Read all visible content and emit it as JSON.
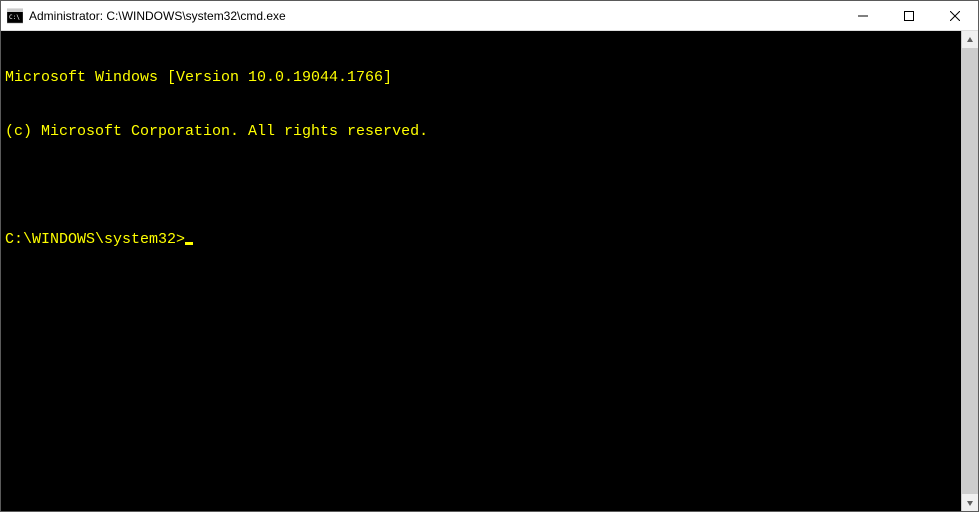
{
  "titlebar": {
    "title": "Administrator: C:\\WINDOWS\\system32\\cmd.exe"
  },
  "terminal": {
    "line1": "Microsoft Windows [Version 10.0.19044.1766]",
    "line2": "(c) Microsoft Corporation. All rights reserved.",
    "prompt": "C:\\WINDOWS\\system32>",
    "text_color": "#ffff00",
    "background_color": "#000000"
  }
}
